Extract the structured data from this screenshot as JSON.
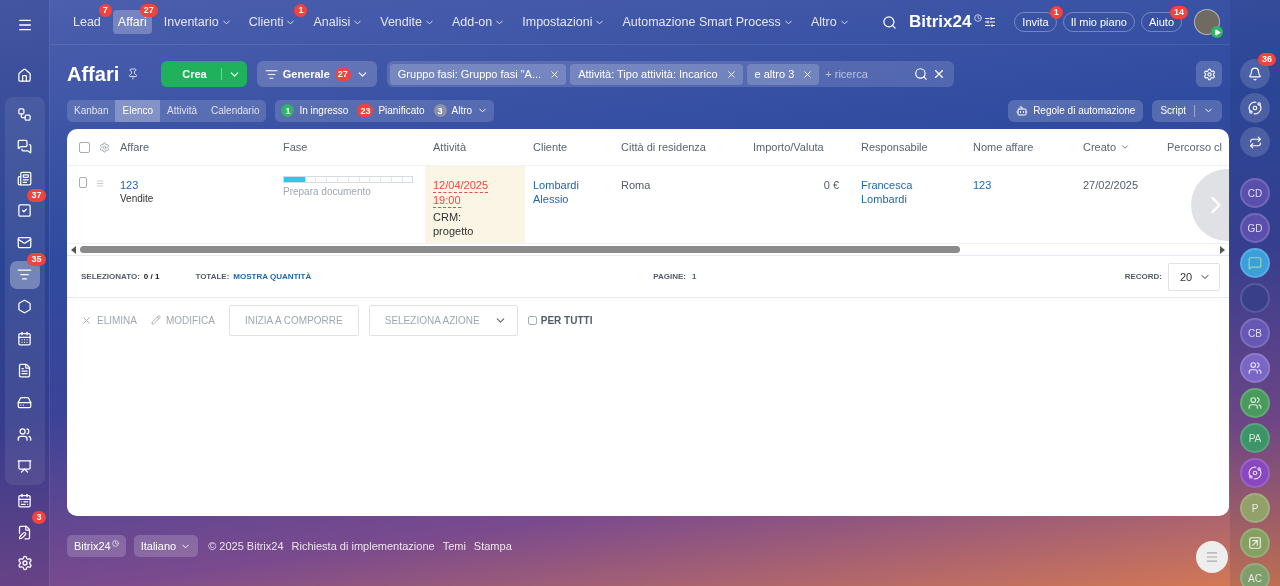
{
  "top_nav": {
    "items": [
      {
        "label": "Lead",
        "badge": "7",
        "dropdown": false,
        "selected": false
      },
      {
        "label": "Affari",
        "badge": "27",
        "dropdown": false,
        "selected": true
      },
      {
        "label": "Inventario",
        "dropdown": true,
        "selected": false
      },
      {
        "label": "Clienti",
        "badge": "1",
        "dropdown": true,
        "selected": false
      },
      {
        "label": "Analisi",
        "dropdown": true,
        "selected": false
      },
      {
        "label": "Vendite",
        "dropdown": true,
        "selected": false
      },
      {
        "label": "Add-on",
        "dropdown": true,
        "selected": false
      },
      {
        "label": "Impostazioni",
        "dropdown": true,
        "selected": false
      },
      {
        "label": "Automazione Smart Process",
        "dropdown": true,
        "selected": false
      },
      {
        "label": "Altro",
        "dropdown": true,
        "selected": false
      }
    ]
  },
  "brand": {
    "name": "Bitrix",
    "suffix": "24"
  },
  "header_buttons": [
    {
      "label": "Invita",
      "badge": "1"
    },
    {
      "label": "Il mio piano"
    },
    {
      "label": "Aiuto",
      "badge": "14"
    }
  ],
  "left_sidebar": {
    "items": [
      {
        "selected": false
      },
      {
        "selected": false
      },
      {
        "selected": false
      },
      {
        "selected": false
      },
      {
        "selected": false,
        "badge": "37"
      },
      {
        "selected": false
      },
      {
        "selected": true,
        "badge": "35"
      },
      {
        "selected": false
      },
      {
        "selected": false
      },
      {
        "selected": false
      },
      {
        "selected": false
      },
      {
        "selected": false
      },
      {
        "selected": false
      },
      {
        "selected": false
      },
      {
        "selected": false,
        "badge": "3"
      }
    ]
  },
  "page": {
    "title": "Affari",
    "create_button": "Crea",
    "preset": {
      "label": "Generale",
      "badge": "27"
    },
    "filter_chips": [
      "Gruppo fasi: Gruppo fasi \"A...",
      "Attività: Tipo attività: Incarico",
      "e altro 3"
    ],
    "search_placeholder": "+ ricerca"
  },
  "view_tabs": [
    {
      "label": "Kanban",
      "selected": false
    },
    {
      "label": "Elenco",
      "selected": true
    },
    {
      "label": "Attività",
      "selected": false
    },
    {
      "label": "Calendario",
      "selected": false
    }
  ],
  "counters": [
    {
      "count": "1",
      "label": "In ingresso",
      "color": "#2fb567"
    },
    {
      "count": "23",
      "label": "Pianificato",
      "color": "#f5413b"
    },
    {
      "count": "3",
      "label": "Altro",
      "color": "#8a93a8",
      "dropdown": true
    }
  ],
  "automation_button": "Regole di automazione",
  "script_button": "Script",
  "table": {
    "columns": [
      {
        "label": "Affare",
        "sorted": false
      },
      {
        "label": "Fase",
        "sorted": false
      },
      {
        "label": "Attività",
        "sorted": false
      },
      {
        "label": "Cliente",
        "sorted": false
      },
      {
        "label": "Città di residenza",
        "sorted": false
      },
      {
        "label": "Importo/Valuta",
        "sorted": false
      },
      {
        "label": "Responsabile",
        "sorted": false
      },
      {
        "label": "Nome affare",
        "sorted": false
      },
      {
        "label": "Creato",
        "sorted": true
      },
      {
        "label": "Percorso cl",
        "sorted": false
      }
    ],
    "select_all_checked": false,
    "rows": [
      {
        "checked": false,
        "deal": "123",
        "category": "Vendite",
        "stage": {
          "level": 0.167,
          "label": "Prepara documento"
        },
        "activity": {
          "date": "12/04/2025",
          "time": "19:00",
          "text": "CRM: progetto"
        },
        "client": "Lombardi Alessio",
        "city": "Roma",
        "amount": "0 €",
        "responsible": "Francesca Lombardi",
        "deal_name": "123",
        "created": "27/02/2025"
      }
    ]
  },
  "footer_stats": {
    "selected_label": "SELEZIONATO:",
    "selected_value": "0 / 1",
    "total_label": "TOTALE:",
    "total_link": "MOSTRA QUANTITÀ",
    "pages_label": "PAGINE:",
    "pages_value": "1",
    "records_label": "RECORD:",
    "records_value": "20"
  },
  "actions": {
    "delete": "ELIMINA",
    "edit": "MODIFICA",
    "compose": "INIZIA A COMPORRE",
    "select_action": "SELEZIONA AZIONE",
    "for_all": {
      "label": "PER TUTTI",
      "checked": false
    }
  },
  "page_footer": {
    "brand": "Bitrix24",
    "language": "Italiano",
    "copyright": "© 2025 Bitrix24",
    "links": [
      "Richiesta di implementazione",
      "Temi",
      "Stampa"
    ]
  },
  "right_sidebar": {
    "notifications_badge": "36",
    "items": [
      {
        "kind": "initials",
        "text": "CD",
        "color": "#5b4fae"
      },
      {
        "kind": "initials",
        "text": "GD",
        "color": "#5b4fae"
      },
      {
        "kind": "chat",
        "color": "#3b9fdc"
      },
      {
        "kind": "photo"
      },
      {
        "kind": "initials",
        "text": "CB",
        "color": "#6657b4"
      },
      {
        "kind": "group",
        "color": "#7a66c4"
      },
      {
        "kind": "group",
        "color": "#4a9a5e"
      },
      {
        "kind": "initials",
        "text": "PA",
        "color": "#3c9568"
      },
      {
        "kind": "spiral",
        "color": "#8a48c0"
      },
      {
        "kind": "initials",
        "text": "P",
        "color": "#93a06a"
      },
      {
        "kind": "task",
        "color": "#86a062"
      },
      {
        "kind": "initials",
        "text": "AC",
        "color": "#7f9e6c"
      }
    ]
  }
}
